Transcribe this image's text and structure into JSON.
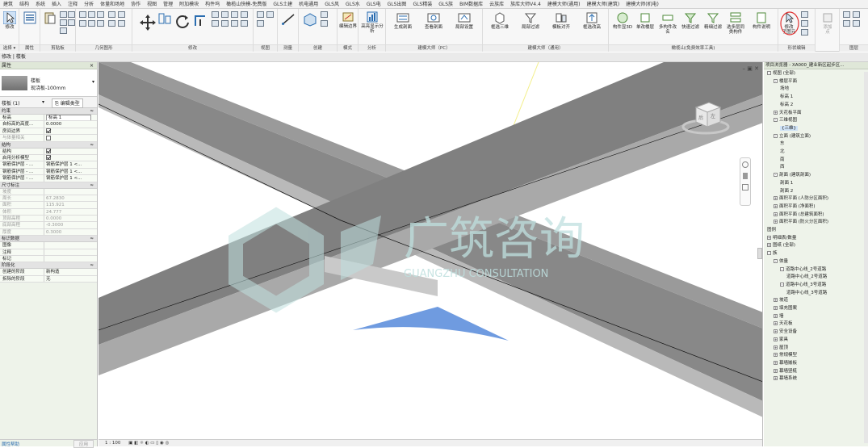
{
  "tabs": [
    "建筑",
    "结构",
    "系统",
    "插入",
    "注释",
    "分析",
    "体量和场地",
    "协作",
    "视图",
    "管理",
    "附加模块",
    "构件坞",
    "橄榄山快模-免费版",
    "GLS土建",
    "机电通用",
    "GLS风",
    "GLS水",
    "GLS电",
    "GLS出图",
    "GLS精装",
    "GLS族",
    "BIM数据库",
    "云族库",
    "族库大师V4.4",
    "建模大师(通用)",
    "建模大师(建筑)",
    "建模大师(机电)"
  ],
  "ribbon": {
    "modify_label": "修改",
    "select_label": "选择 ▾",
    "properties_label": "属性",
    "clipboard_label": "剪贴板",
    "geometry_label": "几何图形",
    "modify_group_label": "修改",
    "view_label": "视图",
    "measure_label": "测量",
    "create_label": "创建",
    "mode_label": "模式",
    "analysis_label": "分析",
    "edit_boundary": "编辑边界",
    "highlight_analysis": "高亮显示分析",
    "jm_pc_buttons": [
      "生成剖面",
      "查看剖面",
      "局部设置"
    ],
    "jm_pc_label": "建模大师（PC）",
    "jm_general_buttons": [
      "框选三维",
      "局部过滤",
      "模板对齐",
      "框选改高"
    ],
    "jm_general_label": "建模大师（通用）",
    "gls_buttons": [
      "构件显3D",
      "单改楼层",
      "多构件改名",
      "快速过滤",
      "精细过滤",
      "选多层同类构件",
      "构件说明"
    ],
    "gls_label": "橄榄山(免费效率工具)",
    "modify_thickness": "修改",
    "modify_thickness2": "子图元",
    "shape_edit_label": "形状编辑",
    "gradient_btn": "坡度",
    "gradient_btn2": "箭头",
    "sub_btn": "添加",
    "sub_btn2": "点",
    "split_label": "拆分",
    "extra_label": "图层"
  },
  "breadcrumb": "修改 | 楼板",
  "properties": {
    "title": "属性",
    "type_family": "楼板",
    "type_name": "现浇板-100mm",
    "instance_selector": "楼板 (1)",
    "edit_type": "编辑类型",
    "sections": [
      {
        "name": "约束",
        "rows": [
          {
            "k": "标高",
            "v": "标高 1",
            "boxed": true
          },
          {
            "k": "自标高的高度...",
            "v": "0.0000"
          },
          {
            "k": "房间边界",
            "v": "",
            "check": "on"
          },
          {
            "k": "与体量相关",
            "v": "",
            "check": "off",
            "dim": true
          }
        ]
      },
      {
        "name": "结构",
        "rows": [
          {
            "k": "结构",
            "v": "",
            "check": "on"
          },
          {
            "k": "启用分析模型",
            "v": "",
            "check": "on"
          },
          {
            "k": "钢筋保护层 - ...",
            "v": "钢筋保护层 1 <..."
          },
          {
            "k": "钢筋保护层 - ...",
            "v": "钢筋保护层 1 <..."
          },
          {
            "k": "钢筋保护层 - ...",
            "v": "钢筋保护层 1 <..."
          }
        ]
      },
      {
        "name": "尺寸标注",
        "rows": [
          {
            "k": "坡度",
            "v": "",
            "dim": true
          },
          {
            "k": "周长",
            "v": "67.2830",
            "dim": true
          },
          {
            "k": "面积",
            "v": "115.921",
            "dim": true
          },
          {
            "k": "体积",
            "v": "24.777",
            "dim": true
          },
          {
            "k": "顶部高程",
            "v": "0.0000",
            "dim": true
          },
          {
            "k": "底部高程",
            "v": "-0.3000",
            "dim": true
          },
          {
            "k": "厚度",
            "v": "0.3000",
            "dim": true
          }
        ]
      },
      {
        "name": "标识数据",
        "rows": [
          {
            "k": "图像",
            "v": ""
          },
          {
            "k": "注释",
            "v": ""
          },
          {
            "k": "标记",
            "v": ""
          }
        ]
      },
      {
        "name": "阶段化",
        "rows": [
          {
            "k": "创建的阶段",
            "v": "新构造"
          },
          {
            "k": "拆除的阶段",
            "v": "无"
          }
        ]
      }
    ],
    "help_link": "属性帮助",
    "apply_button": "应用"
  },
  "viewport": {
    "watermark_text": "广筑咨询",
    "watermark_sub": "GUANGZHU CONSULTATION",
    "viewcube_faces": [
      "后",
      "左"
    ],
    "window_controls": [
      "–",
      "▣",
      "✕"
    ]
  },
  "browser": {
    "title": "项目浏览器 - XA000_建业新区起步区...",
    "items": [
      {
        "lvl": 0,
        "t": "视图 (全部)",
        "tg": "-"
      },
      {
        "lvl": 1,
        "t": "楼层平面",
        "tg": "-"
      },
      {
        "lvl": 2,
        "t": "场地"
      },
      {
        "lvl": 2,
        "t": "标高 1"
      },
      {
        "lvl": 2,
        "t": "标高 2"
      },
      {
        "lvl": 1,
        "t": "天花板平面",
        "tg": "+"
      },
      {
        "lvl": 1,
        "t": "三维视图",
        "tg": "-"
      },
      {
        "lvl": 2,
        "t": "{三维}",
        "sel": true
      },
      {
        "lvl": 1,
        "t": "立面 (建筑立面)",
        "tg": "-"
      },
      {
        "lvl": 2,
        "t": "东"
      },
      {
        "lvl": 2,
        "t": "北"
      },
      {
        "lvl": 2,
        "t": "南"
      },
      {
        "lvl": 2,
        "t": "西"
      },
      {
        "lvl": 1,
        "t": "剖面 (建筑剖面)",
        "tg": "-"
      },
      {
        "lvl": 2,
        "t": "剖面 1"
      },
      {
        "lvl": 2,
        "t": "剖面 2"
      },
      {
        "lvl": 1,
        "t": "面积平面 (人防分区面积)",
        "tg": "+"
      },
      {
        "lvl": 1,
        "t": "面积平面 (净面积)",
        "tg": "+"
      },
      {
        "lvl": 1,
        "t": "面积平面 (总建筑面积)",
        "tg": "+"
      },
      {
        "lvl": 1,
        "t": "面积平面 (防火分区面积)",
        "tg": "+"
      },
      {
        "lvl": 0,
        "t": "图例"
      },
      {
        "lvl": 0,
        "t": "明细表/数量",
        "tg": "+"
      },
      {
        "lvl": 0,
        "t": "图纸 (全部)",
        "tg": "+"
      },
      {
        "lvl": 0,
        "t": "族",
        "tg": "-"
      },
      {
        "lvl": 1,
        "t": "体量",
        "tg": "-"
      },
      {
        "lvl": 2,
        "t": "道路中心线_2号道路",
        "tg": "-"
      },
      {
        "lvl": 3,
        "t": "道路中心线_2号道路"
      },
      {
        "lvl": 2,
        "t": "道路中心线_3号道路",
        "tg": "-"
      },
      {
        "lvl": 3,
        "t": "道路中心线_3号道路"
      },
      {
        "lvl": 1,
        "t": "坡道",
        "tg": "+"
      },
      {
        "lvl": 1,
        "t": "填充图案",
        "tg": "+"
      },
      {
        "lvl": 1,
        "t": "墙",
        "tg": "+"
      },
      {
        "lvl": 1,
        "t": "天花板",
        "tg": "+"
      },
      {
        "lvl": 1,
        "t": "安全设备",
        "tg": "+"
      },
      {
        "lvl": 1,
        "t": "家具",
        "tg": "+"
      },
      {
        "lvl": 1,
        "t": "屋顶",
        "tg": "+"
      },
      {
        "lvl": 1,
        "t": "常规模型",
        "tg": "+"
      },
      {
        "lvl": 1,
        "t": "幕墙嵌板",
        "tg": "+"
      },
      {
        "lvl": 1,
        "t": "幕墙竖梃",
        "tg": "+"
      },
      {
        "lvl": 1,
        "t": "幕墙系统",
        "tg": "+"
      }
    ]
  },
  "statusbar": {
    "scale": "1 : 100"
  },
  "colors": {
    "accent": "#2a6db0",
    "panel": "#eef3ea",
    "beam": "#8a8a8a",
    "watermark": "#bfe0df",
    "blue_shape": "#6f9be0",
    "highlight_circle": "#e03030"
  }
}
